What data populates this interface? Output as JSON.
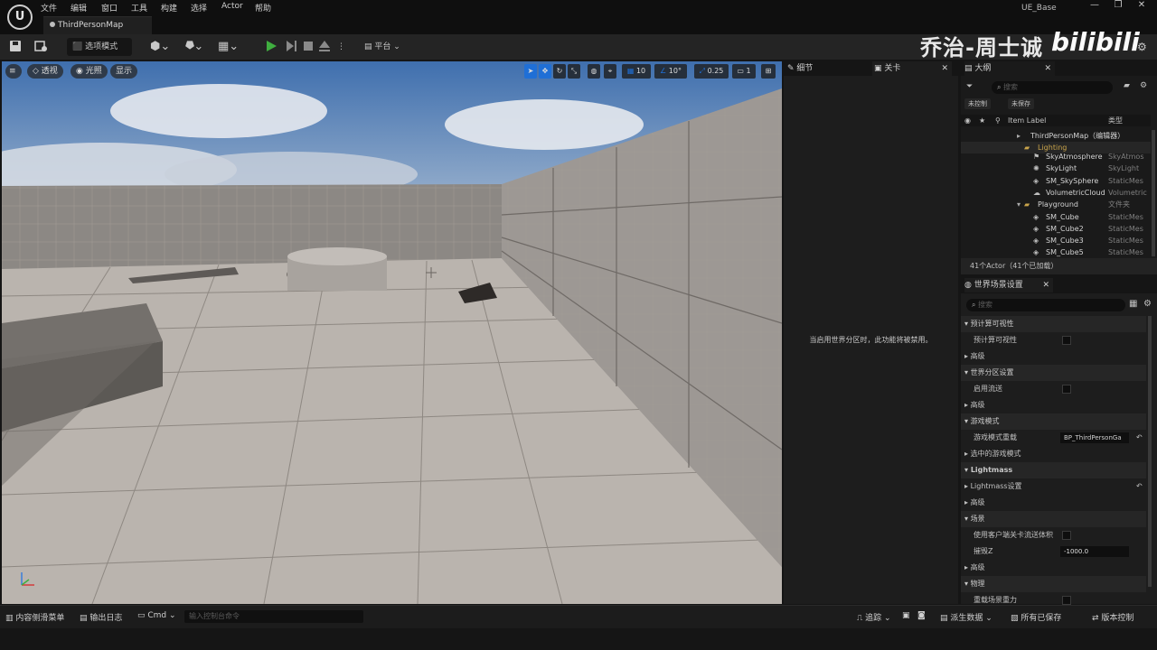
{
  "app": {
    "menu": [
      "文件",
      "编辑",
      "窗口",
      "工具",
      "构建",
      "选择",
      "Actor",
      "帮助"
    ],
    "project": "UE_Base",
    "tab_title": "ThirdPersonMap",
    "window_controls": [
      "—",
      "❐",
      "✕"
    ]
  },
  "toolbar": {
    "select_mode": "选项模式",
    "platform": "平台",
    "watermark": "乔治-周士诚",
    "bili_logo": "bilibili"
  },
  "viewport": {
    "perspective": "透视",
    "lit": "光照",
    "show": "显示",
    "grid_snap": "10",
    "rot_snap": "10°",
    "scale_snap": "0.25",
    "camera_speed": "1"
  },
  "details": {
    "tab_details": "细节",
    "tab_level": "关卡",
    "disabled_msg": "当启用世界分区时，此功能将被禁用。"
  },
  "outliner": {
    "title": "大纲",
    "search_placeholder": "搜索",
    "filter_unversioned": "未控制",
    "filter_unsaved": "未保存",
    "col_label": "Item Label",
    "col_type": "类型",
    "items": [
      {
        "name": "ThirdPersonMap（编辑器）",
        "type": ""
      },
      {
        "name": "Lighting",
        "type": ""
      },
      {
        "name": "SkyAtmosphere",
        "type": "SkyAtmos"
      },
      {
        "name": "SkyLight",
        "type": "SkyLight"
      },
      {
        "name": "SM_SkySphere",
        "type": "StaticMes"
      },
      {
        "name": "VolumetricCloud",
        "type": "Volumetric"
      },
      {
        "name": "Playground",
        "type": "文件夹"
      },
      {
        "name": "SM_Cube",
        "type": "StaticMes"
      },
      {
        "name": "SM_Cube2",
        "type": "StaticMes"
      },
      {
        "name": "SM_Cube3",
        "type": "StaticMes"
      },
      {
        "name": "SM_Cube5",
        "type": "StaticMes"
      }
    ],
    "count": "41个Actor（41个已加载）"
  },
  "world_settings": {
    "title": "世界场景设置",
    "search_placeholder": "搜索",
    "rows": [
      {
        "label": "预计算可视性",
        "kind": "section"
      },
      {
        "label": "预计算可视性",
        "kind": "check"
      },
      {
        "label": "高级",
        "kind": "sub"
      },
      {
        "label": "世界分区设置",
        "kind": "section"
      },
      {
        "label": "启用流送",
        "kind": "check"
      },
      {
        "label": "高级",
        "kind": "sub"
      },
      {
        "label": "游戏模式",
        "kind": "section"
      },
      {
        "label": "游戏模式重载",
        "kind": "dropdown"
      },
      {
        "label": "选中的游戏模式",
        "kind": "sub"
      },
      {
        "label": "Lightmass",
        "kind": "section"
      },
      {
        "label": "Lightmass设置",
        "kind": "sub"
      },
      {
        "label": "高级",
        "kind": "sub"
      },
      {
        "label": "场景",
        "kind": "section"
      },
      {
        "label": "使用客户端关卡流送体积",
        "kind": "check"
      },
      {
        "label": "摧毁Z",
        "kind": "input"
      },
      {
        "label": "高级",
        "kind": "sub"
      },
      {
        "label": "物理",
        "kind": "section"
      },
      {
        "label": "重载场景重力",
        "kind": "check"
      }
    ],
    "gamemode_value": "BP_ThirdPersonGa",
    "killz_value": "-1000.0"
  },
  "statusbar": {
    "content_drawer": "内容侧滑菜单",
    "output_log": "输出日志",
    "cmd": "Cmd",
    "cmd_placeholder": "输入控制台命令",
    "trace": "追踪",
    "derived_data": "派生数据",
    "all_saved": "所有已保存",
    "revision_control": "版本控制"
  },
  "colors": {
    "play_green": "#3fae3f",
    "accent_blue": "#1f6fd6",
    "folder": "#c9a44b"
  }
}
